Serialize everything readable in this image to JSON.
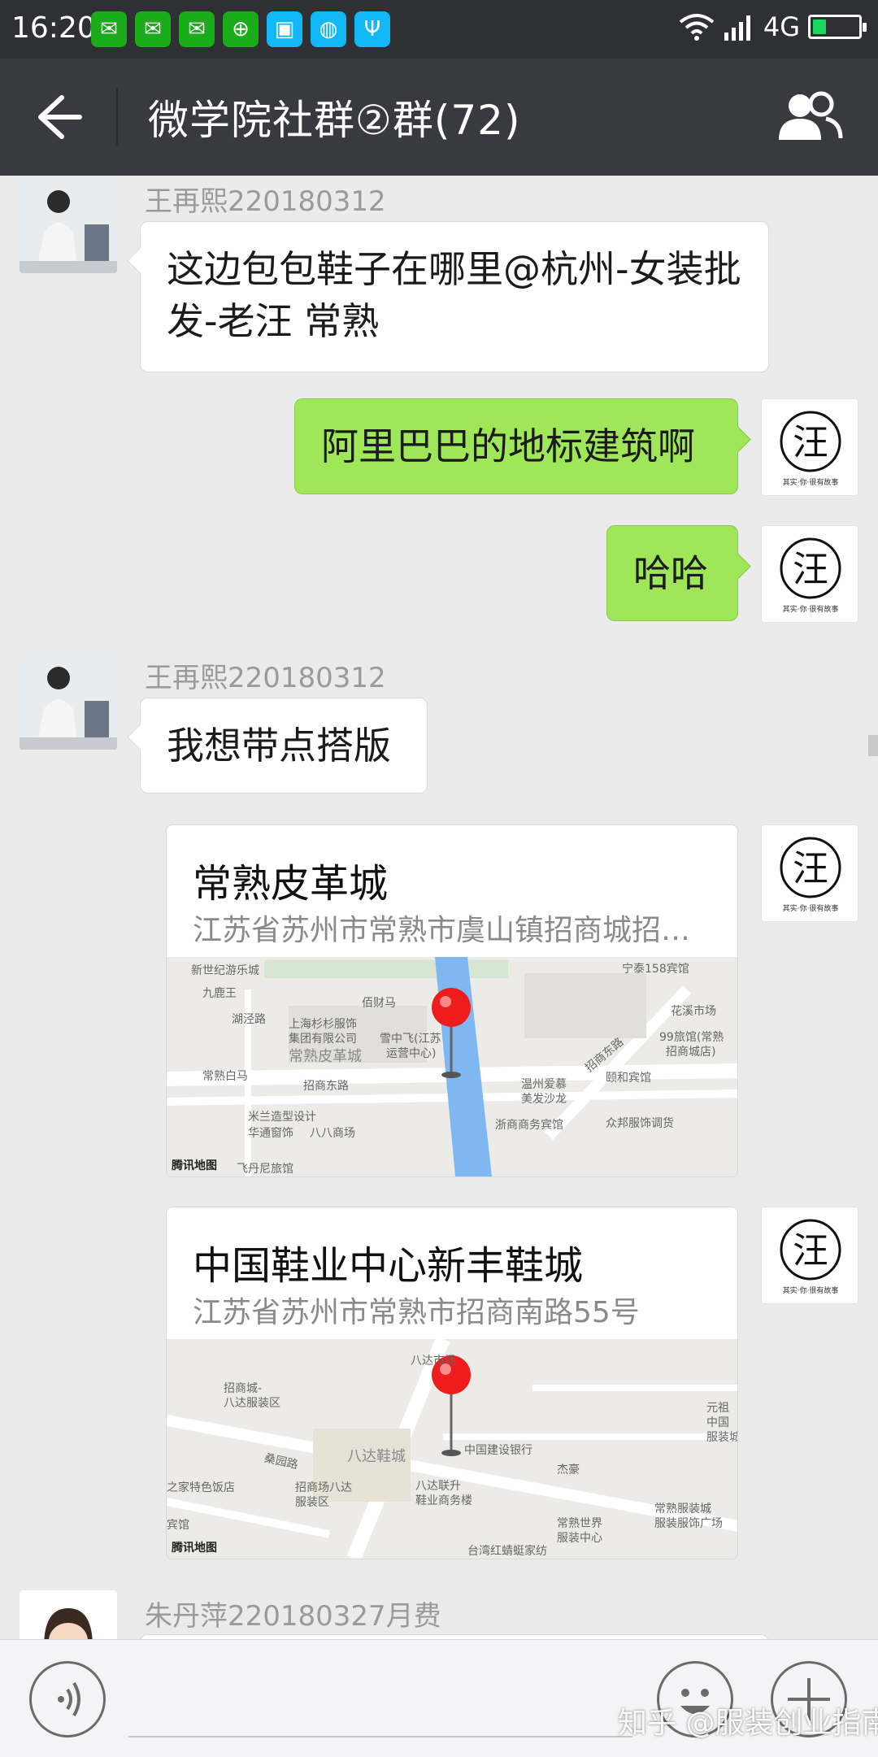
{
  "status": {
    "time": "16:20",
    "network": "4G",
    "battery_level": 0.3,
    "apps": [
      {
        "name": "wechat-icon",
        "color": "#1aad19"
      },
      {
        "name": "wechat-icon",
        "color": "#1aad19"
      },
      {
        "name": "wechat-icon",
        "color": "#1aad19"
      },
      {
        "name": "plus-circle-icon",
        "color": "#1aad19"
      },
      {
        "name": "scan-icon",
        "color": "#12b7f5"
      },
      {
        "name": "basketball-icon",
        "color": "#12b7f5"
      },
      {
        "name": "usb-icon",
        "color": "#12b7f5"
      }
    ]
  },
  "header": {
    "title": "微学院社群②群(72)"
  },
  "messages": {
    "m1": {
      "sender": "王再熙220180312",
      "text": "这边包包鞋子在哪里@杭州-女装批发-老汪  常熟"
    },
    "m2": {
      "text": "阿里巴巴的地标建筑啊"
    },
    "m3": {
      "text": "哈哈"
    },
    "m4": {
      "sender": "王再熙220180312",
      "text": "我想带点搭版"
    },
    "m7": {
      "sender": "朱丹萍220180327月费"
    }
  },
  "avatar_text": {
    "char": "汪",
    "tagline": "其实·你·很有故事"
  },
  "locations": [
    {
      "title": "常熟皮革城",
      "address": "江苏省苏州市常熟市虞山镇招商城招商…",
      "map_labels": [
        "新世纪游乐城",
        "九鹿王",
        "湖泾路",
        "佰财马",
        "上海杉杉服饰",
        "集团有限公司",
        "常熟皮革城",
        "雪中飞(江苏",
        "运营中心)",
        "招商东路",
        "常熟白马",
        "米兰造型设计",
        "华通窗饰",
        "八八商场",
        "温州爱慕",
        "美发沙龙",
        "浙商商务宾馆",
        "众邦服饰调货",
        "颐和宾馆",
        "宁泰158宾馆",
        "花溪市场",
        "99旅馆(常熟",
        "招商城店)",
        "招商东路",
        "飞丹尼旅馆",
        "腾讯地图"
      ]
    },
    {
      "title": "中国鞋业中心新丰鞋城",
      "address": "江苏省苏州市常熟市招商南路55号",
      "map_labels": [
        "八达市场",
        "招商城-",
        "八达服装区",
        "八达鞋城",
        "中国建设银行",
        "杰豪",
        "元祖",
        "中国",
        "服装城",
        "桑园路",
        "之家特色饭店",
        "招商场八达",
        "服装区",
        "八达联升",
        "鞋业商务楼",
        "常熟服装城",
        "服装服饰广场",
        "常熟世界",
        "服装中心",
        "宾馆",
        "台湾红蜻蜓家纺",
        "腾讯地图"
      ]
    }
  ],
  "bottom": {
    "watermark": "知乎 @服装创业指南"
  }
}
